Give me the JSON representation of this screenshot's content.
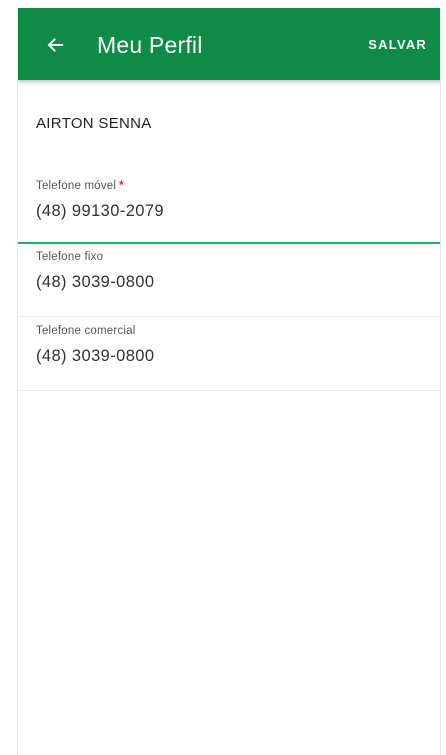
{
  "appbar": {
    "title": "Meu Perfil",
    "back_icon": "arrow-left-icon",
    "save_label": "SALVAR",
    "color": "#0e8c45"
  },
  "profile": {
    "name": "AIRTON SENNA"
  },
  "fields": {
    "mobile": {
      "label": "Telefone móvel",
      "required_mark": "*",
      "value": "(48) 99130-2079"
    },
    "home": {
      "label": "Telefone fixo",
      "value": "(48) 3039-0800"
    },
    "work": {
      "label": "Telefone comercial",
      "value": "(48) 3039-0800"
    }
  },
  "colors": {
    "accent": "#1fae61",
    "required": "#e02424"
  }
}
